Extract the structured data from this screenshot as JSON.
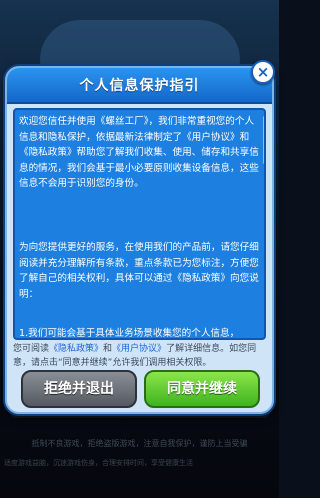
{
  "dialog": {
    "title": "个人信息保护指引",
    "close_label": "×",
    "paragraph1": "欢迎您信任并使用《螺丝工厂》，我们非常重视您的个人信息和隐私保护，依据最新法律制定了《用户协议》和《隐私政策》帮助您了解我们收集、使用、储存和共享信息的情况，我们会基于最小必要原则收集设备信息，这些信息不会用于识别您的身份。",
    "paragraph2": "为向您提供更好的服务，在使用我们的产品前，请您仔细阅读并充分理解所有条款，重点条款已为您标注，方便您了解自己的相关权利，具体可以通过《隐私政策》向您说明：",
    "paragraph3": "1.我们可能会基于具体业务场景收集您的个人信息，",
    "notice_prefix": "您可阅读",
    "notice_link1": "《隐私政策》",
    "notice_and": "和",
    "notice_link2": "《用户协议》",
    "notice_suffix": "了解详细信息。如您同意，请点击“同意并继续”允许我们调用相关权限。",
    "reject_label": "拒绝并退出",
    "agree_label": "同意并继续"
  },
  "background": {
    "footer_line1": "抵制不良游戏，拒绝盗版游戏，注意自我保护，谨防上当受骗",
    "footer_line2": "适度游戏益脑，沉迷游戏伤身，合理安排时间，享受健康生活"
  }
}
